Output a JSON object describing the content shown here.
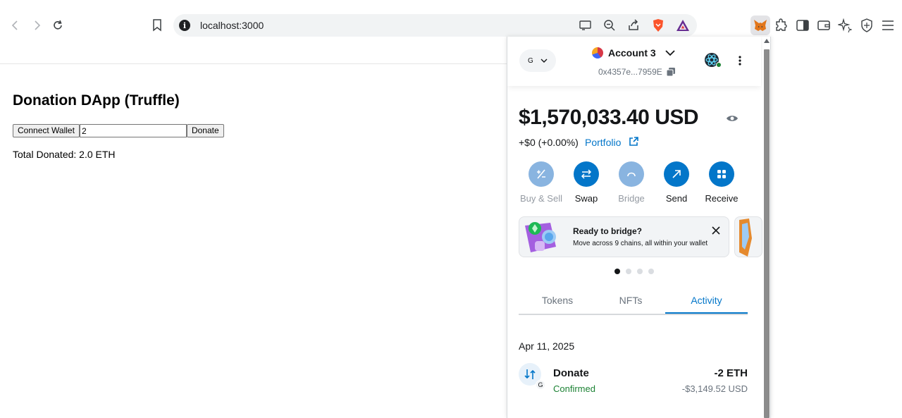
{
  "browser": {
    "url": "localhost:3000"
  },
  "page": {
    "title": "Donation DApp (Truffle)",
    "connect_label": "Connect Wallet",
    "amount_value": "2",
    "donate_label": "Donate",
    "total": "Total Donated: 2.0 ETH"
  },
  "wallet": {
    "network_initial": "G",
    "account_name": "Account 3",
    "address": "0x4357e...7959E",
    "balance": "$1,570,033.40",
    "currency": "USD",
    "change": "+$0 (+0.00%)",
    "portfolio_label": "Portfolio",
    "actions": [
      {
        "label": "Buy & Sell",
        "enabled": false
      },
      {
        "label": "Swap",
        "enabled": true
      },
      {
        "label": "Bridge",
        "enabled": false
      },
      {
        "label": "Send",
        "enabled": true
      },
      {
        "label": "Receive",
        "enabled": true
      }
    ],
    "banner": {
      "title": "Ready to bridge?",
      "subtitle": "Move across 9 chains, all within your wallet"
    },
    "tabs": [
      "Tokens",
      "NFTs",
      "Activity"
    ],
    "active_tab": "Activity",
    "activity": {
      "date": "Apr 11, 2025",
      "items": [
        {
          "name": "Donate",
          "status": "Confirmed",
          "amount": "-2 ETH",
          "fiat": "-$3,149.52 USD",
          "badge": "G"
        }
      ]
    },
    "colors": {
      "primary": "#0376c9",
      "success": "#1c8234"
    }
  }
}
